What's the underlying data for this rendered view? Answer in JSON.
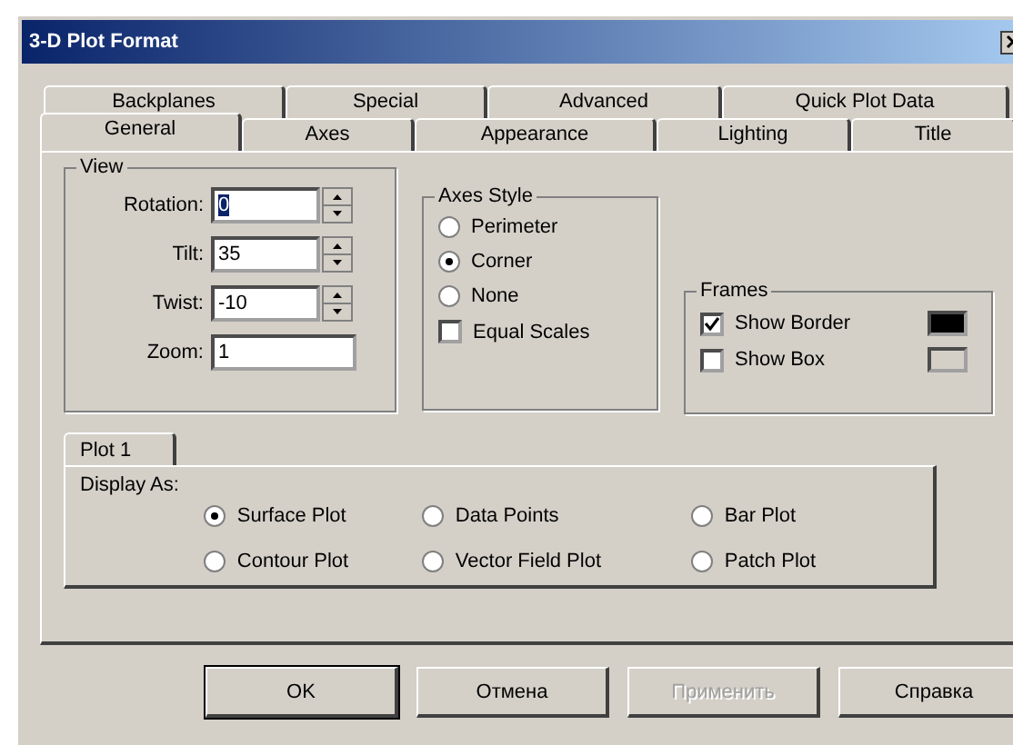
{
  "window": {
    "title": "3-D Plot Format"
  },
  "tabs_back": [
    {
      "label": "Backplanes",
      "selected": false
    },
    {
      "label": "Special",
      "selected": false
    },
    {
      "label": "Advanced",
      "selected": false
    },
    {
      "label": "Quick Plot Data",
      "selected": false
    }
  ],
  "tabs_front": [
    {
      "label": "General",
      "selected": true
    },
    {
      "label": "Axes",
      "selected": false
    },
    {
      "label": "Appearance",
      "selected": false
    },
    {
      "label": "Lighting",
      "selected": false
    },
    {
      "label": "Title",
      "selected": false
    }
  ],
  "view": {
    "title": "View",
    "fields": [
      {
        "label": "Rotation:",
        "value": "0",
        "spinner": true,
        "text_selected": true
      },
      {
        "label": "Tilt:",
        "value": "35",
        "spinner": true,
        "text_selected": false
      },
      {
        "label": "Twist:",
        "value": "-10",
        "spinner": true,
        "text_selected": false
      },
      {
        "label": "Zoom:",
        "value": "1",
        "spinner": false,
        "text_selected": false
      }
    ]
  },
  "axes_style": {
    "title": "Axes Style",
    "options": [
      {
        "label": "Perimeter",
        "selected": false
      },
      {
        "label": "Corner",
        "selected": true
      },
      {
        "label": "None",
        "selected": false
      }
    ],
    "equal_scales": {
      "label": "Equal Scales",
      "checked": false
    }
  },
  "frames": {
    "title": "Frames",
    "items": [
      {
        "label": "Show Border",
        "checked": true,
        "color": "#000000"
      },
      {
        "label": "Show Box",
        "checked": false,
        "color": "#d4d0c8"
      }
    ]
  },
  "plot_tabs": [
    {
      "label": "Plot 1",
      "selected": true
    }
  ],
  "display_as": {
    "label": "Display As:",
    "options": [
      {
        "label": "Surface Plot",
        "selected": true
      },
      {
        "label": "Data Points",
        "selected": false
      },
      {
        "label": "Bar Plot",
        "selected": false
      },
      {
        "label": "Contour Plot",
        "selected": false
      },
      {
        "label": "Vector Field Plot",
        "selected": false
      },
      {
        "label": "Patch Plot",
        "selected": false
      }
    ]
  },
  "buttons": [
    {
      "label": "OK",
      "disabled": false,
      "default": true
    },
    {
      "label": "Отмена",
      "disabled": false,
      "default": false
    },
    {
      "label": "Применить",
      "disabled": true,
      "default": false
    },
    {
      "label": "Справка",
      "disabled": false,
      "default": false
    }
  ]
}
